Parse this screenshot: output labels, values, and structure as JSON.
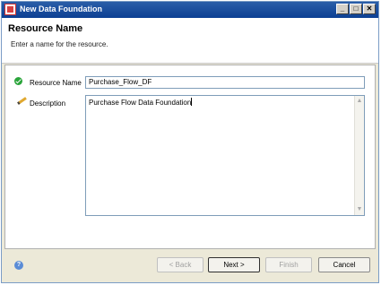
{
  "window": {
    "title": "New Data Foundation",
    "minimize_glyph": "_",
    "maximize_glyph": "□",
    "close_glyph": "✕"
  },
  "header": {
    "title": "Resource Name",
    "subtitle": "Enter a name for the resource."
  },
  "form": {
    "name_label": "Resource Name",
    "name_value": "Purchase_Flow_DF",
    "description_label": "Description",
    "description_value": "Purchase Flow Data Foundation"
  },
  "scrollbar": {
    "up_glyph": "▲",
    "down_glyph": "▼"
  },
  "footer": {
    "help_glyph": "?",
    "back_label": "< Back",
    "next_label": "Next >",
    "finish_label": "Finish",
    "cancel_label": "Cancel"
  }
}
